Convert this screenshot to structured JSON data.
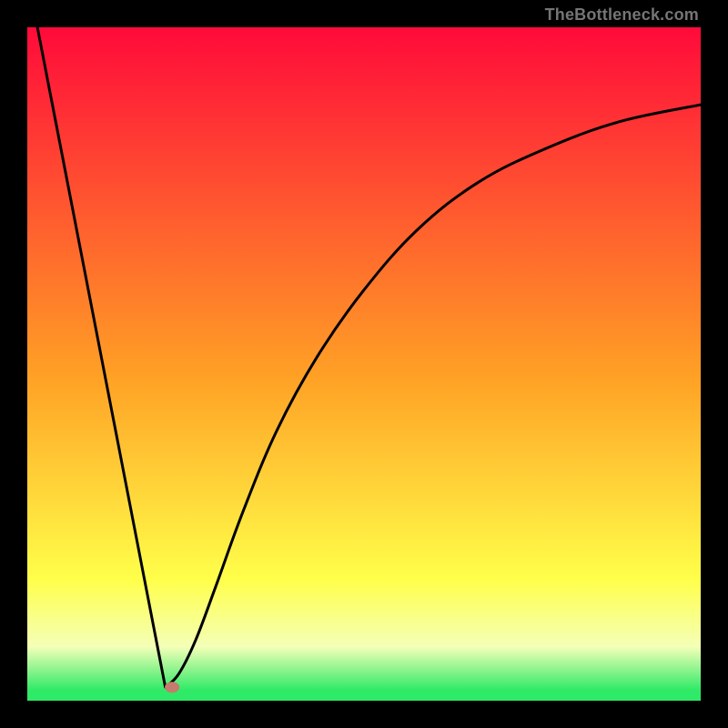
{
  "attribution": "TheBottleneck.com",
  "colors": {
    "frame": "#000000",
    "curve": "#000000",
    "marker_fill": "#c77a6e",
    "gradient_red": "#ff0a3a",
    "gradient_orange": "#ffa125",
    "gradient_yellow": "#ffff4a",
    "gradient_pale": "#f4ffb7",
    "gradient_green": "#2eea66"
  },
  "chart_data": {
    "type": "line",
    "title": "",
    "xlabel": "",
    "ylabel": "",
    "xlim": [
      0,
      1
    ],
    "ylim": [
      0,
      1
    ],
    "series": [
      {
        "name": "left-branch",
        "x": [
          0.015,
          0.205
        ],
        "y": [
          1.0,
          0.02
        ]
      },
      {
        "name": "right-branch",
        "x": [
          0.205,
          0.225,
          0.25,
          0.28,
          0.32,
          0.37,
          0.43,
          0.5,
          0.58,
          0.67,
          0.77,
          0.88,
          1.0
        ],
        "y": [
          0.02,
          0.04,
          0.09,
          0.17,
          0.28,
          0.4,
          0.51,
          0.61,
          0.7,
          0.77,
          0.82,
          0.86,
          0.885
        ]
      }
    ],
    "marker": {
      "x": 0.215,
      "y": 0.02
    },
    "gradient_bands": [
      {
        "start": 0.0,
        "color": "gradient_red"
      },
      {
        "start": 0.52,
        "color": "gradient_orange"
      },
      {
        "start": 0.82,
        "color": "gradient_yellow"
      },
      {
        "start": 0.92,
        "color": "gradient_pale"
      },
      {
        "start": 0.985,
        "color": "gradient_green"
      }
    ]
  }
}
